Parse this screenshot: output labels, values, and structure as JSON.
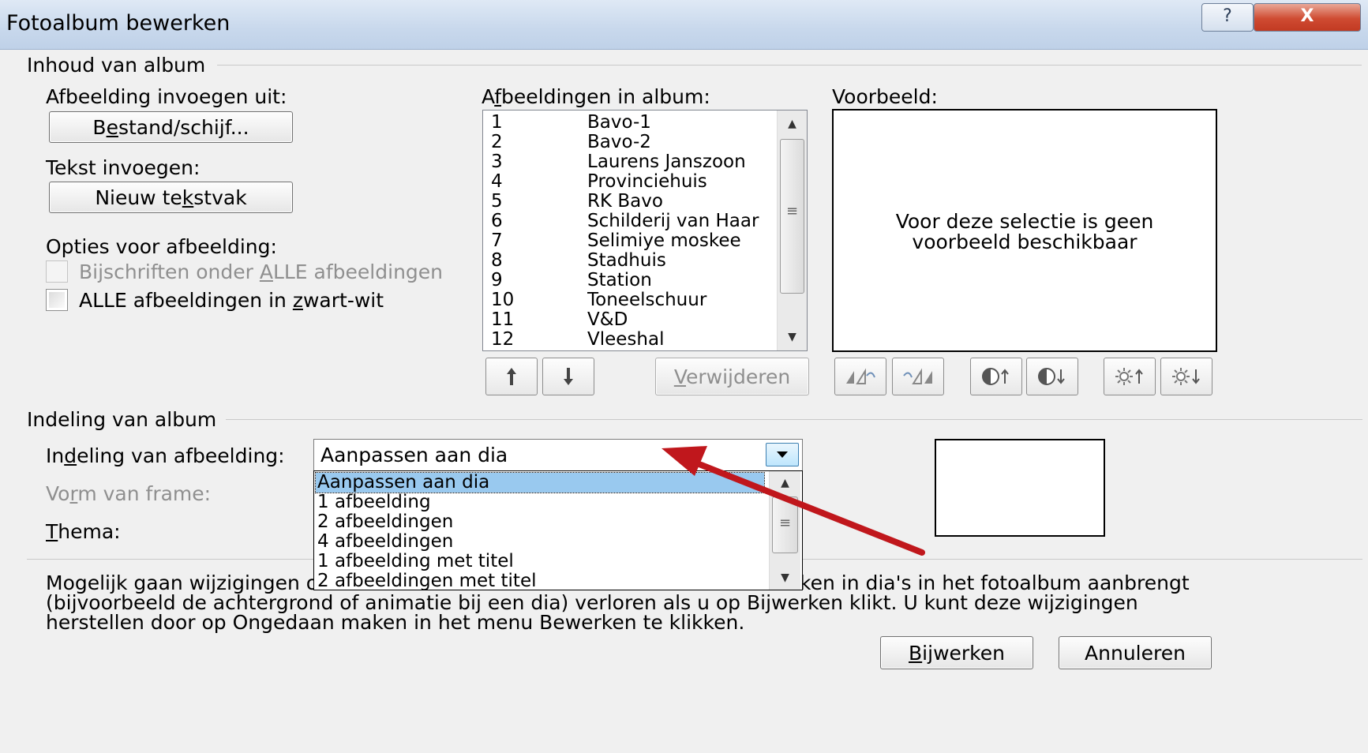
{
  "window": {
    "title": "Fotoalbum bewerken",
    "help_label": "?",
    "close_label": "X"
  },
  "album_content": {
    "group_label": "Inhoud van album",
    "insert_picture_label": "Afbeelding invoegen uit:",
    "file_button": {
      "pre": "B",
      "u": "e",
      "post": "stand/schijf..."
    },
    "insert_text_label": "Tekst invoegen:",
    "new_textbox_button": {
      "pre": "Nieuw te",
      "u": "k",
      "post": "stvak"
    },
    "picture_options_label": "Opties voor afbeelding:",
    "captions_checkbox": {
      "pre": "Bijschriften onder ",
      "u": "A",
      "post": "LLE afbeeldingen",
      "checked": false,
      "enabled": false
    },
    "bw_checkbox": {
      "pre": "ALLE afbeeldingen in ",
      "u": "z",
      "post": "wart-wit",
      "checked": false,
      "enabled": true
    }
  },
  "pictures_list": {
    "label": {
      "pre": "A",
      "u": "f",
      "post": "beeldingen in album:"
    },
    "items": [
      {
        "num": "1",
        "name": "Bavo-1"
      },
      {
        "num": "2",
        "name": "Bavo-2"
      },
      {
        "num": "3",
        "name": "Laurens Janszoon"
      },
      {
        "num": "4",
        "name": "Provinciehuis"
      },
      {
        "num": "5",
        "name": "RK Bavo"
      },
      {
        "num": "6",
        "name": "Schilderij van Haar"
      },
      {
        "num": "7",
        "name": "Selimiye moskee"
      },
      {
        "num": "8",
        "name": "Stadhuis"
      },
      {
        "num": "9",
        "name": "Station"
      },
      {
        "num": "10",
        "name": "Toneelschuur"
      },
      {
        "num": "11",
        "name": "V&D"
      },
      {
        "num": "12",
        "name": "Vleeshal"
      }
    ],
    "move_up_icon": "arrow-up-icon",
    "move_down_icon": "arrow-down-icon",
    "remove_button": {
      "pre": "",
      "u": "V",
      "post": "erwijderen"
    }
  },
  "preview": {
    "label": "Voorbeeld:",
    "message_line1": "Voor deze selectie is geen",
    "message_line2": "voorbeeld beschikbaar",
    "tool_icons": [
      "rotate-left-icon",
      "rotate-right-icon",
      "contrast-up-icon",
      "contrast-down-icon",
      "brightness-up-icon",
      "brightness-down-icon"
    ]
  },
  "album_layout": {
    "group_label": "Indeling van album",
    "picture_layout_label": {
      "pre": "In",
      "u": "d",
      "post": "eling van afbeelding:"
    },
    "picture_layout_value": "Aanpassen aan dia",
    "frame_shape_label": {
      "pre": "Vo",
      "u": "r",
      "post": "m van frame:"
    },
    "theme_label": {
      "pre": "",
      "u": "T",
      "post": "hema:"
    },
    "dropdown_options": [
      "Aanpassen aan dia",
      "1 afbeelding",
      "2 afbeeldingen",
      "4 afbeeldingen",
      "1 afbeelding met titel",
      "2 afbeeldingen met titel"
    ],
    "selected_option": "Aanpassen aan dia"
  },
  "notice": {
    "line1_start": "Mogelijk gaan wijzigingen o",
    "line1_end": "ken in dia's in het fotoalbum aanbrengt",
    "line2": "(bijvoorbeeld de achtergrond of animatie bij een dia) verloren als u op Bijwerken klikt. U kunt deze wijzigingen",
    "line3": "herstellen door op Ongedaan maken in het menu Bewerken te klikken."
  },
  "footer": {
    "update_button": {
      "pre": "",
      "u": "B",
      "post": "ijwerken"
    },
    "cancel_button": "Annuleren"
  },
  "colors": {
    "selection": "#99c9ef",
    "annotation_arrow": "#c0171c",
    "close_button": "#c23a22"
  }
}
